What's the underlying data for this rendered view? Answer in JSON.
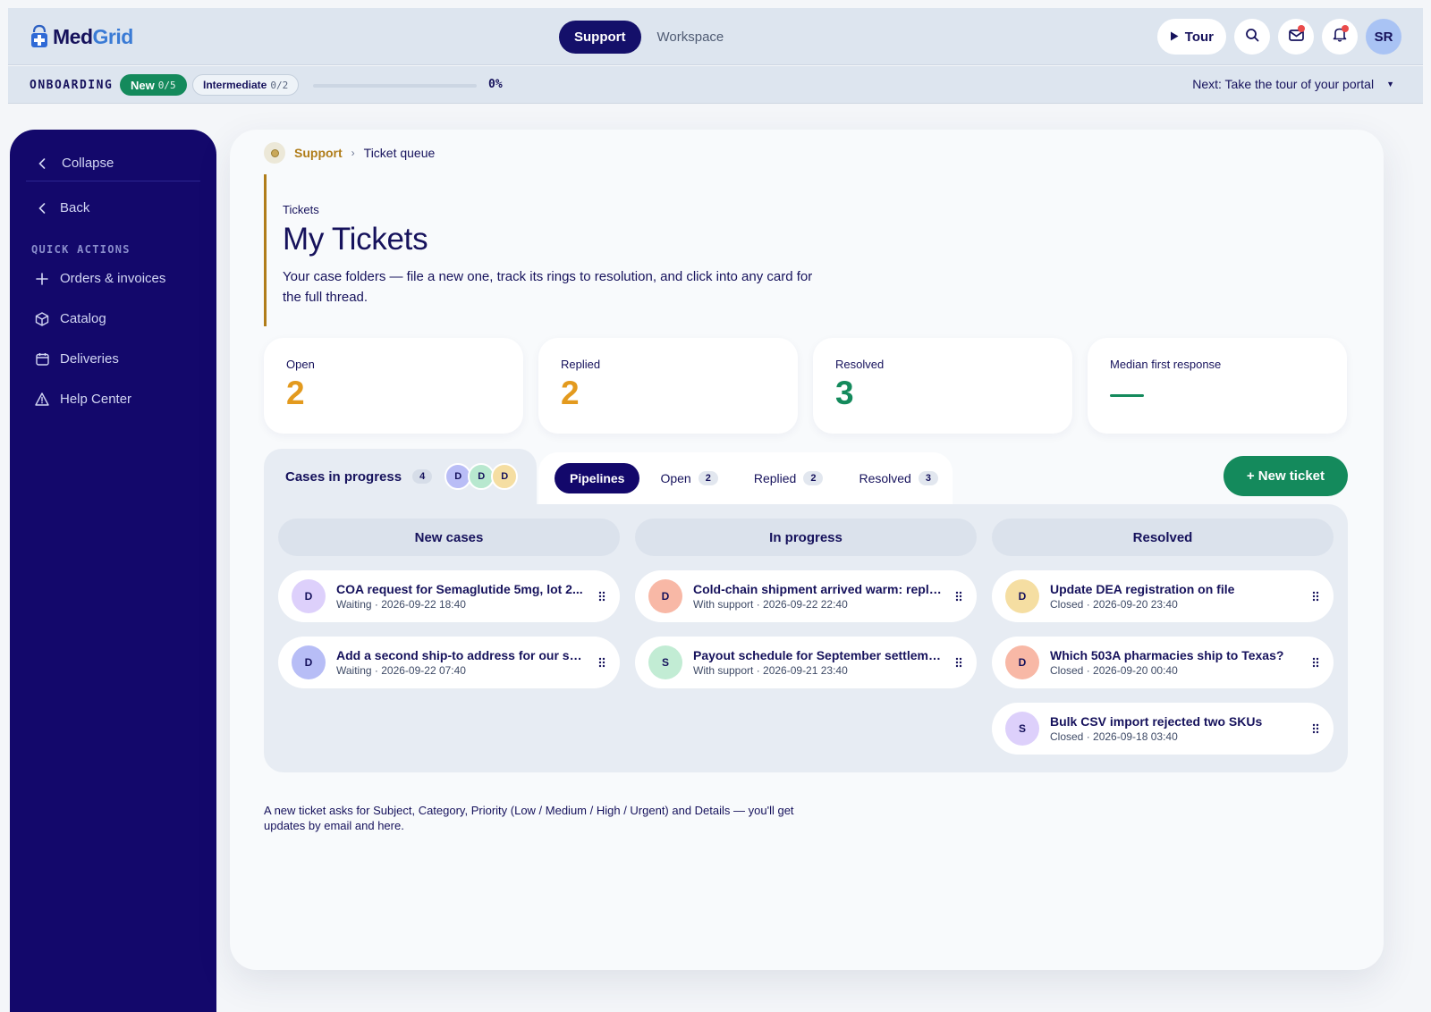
{
  "brand": {
    "name_part1": "Med",
    "name_part2": "Grid"
  },
  "header": {
    "nav": [
      {
        "label": "Support",
        "active": true
      },
      {
        "label": "Workspace",
        "active": false
      }
    ],
    "tour_label": "Tour",
    "user_initials": "SR",
    "icons": [
      "play-icon",
      "search-icon",
      "mail-icon",
      "bell-icon"
    ]
  },
  "onboarding": {
    "label": "ONBOARDING",
    "new_label": "New",
    "new_count": "0/5",
    "intermediate_label": "Intermediate",
    "intermediate_count": "0/2",
    "progress_percent": 0,
    "progress_text": "0%",
    "next_text": "Next: Take the tour of your portal"
  },
  "sidebar": {
    "collapse": "Collapse",
    "back": "Back",
    "section_heading": "QUICK ACTIONS",
    "items": [
      {
        "label": "Orders & invoices",
        "icon": "plus-icon"
      },
      {
        "label": "Catalog",
        "icon": "box-icon"
      },
      {
        "label": "Deliveries",
        "icon": "calendar-icon"
      },
      {
        "label": "Help Center",
        "icon": "warning-icon"
      }
    ]
  },
  "breadcrumb": {
    "root": "Support",
    "current": "Ticket queue"
  },
  "hero": {
    "eyebrow": "Tickets",
    "title": "My Tickets",
    "description": "Your case folders — file a new one, track its rings to resolution, and click into any card for the full thread."
  },
  "stats": [
    {
      "label": "Open",
      "value": "2",
      "color": "#e39a1e"
    },
    {
      "label": "Replied",
      "value": "2",
      "color": "#e39a1e"
    },
    {
      "label": "Resolved",
      "value": "3",
      "color": "#148a5c"
    },
    {
      "label": "Median first response",
      "value": "",
      "color": "#148a5c"
    }
  ],
  "board": {
    "cases_title": "Cases in progress",
    "cases_count": "4",
    "avatars": [
      {
        "initial": "D",
        "color": "#b9bdf6"
      },
      {
        "initial": "D",
        "color": "#b8e8cf"
      },
      {
        "initial": "D",
        "color": "#f5dea2"
      }
    ],
    "tabs": [
      {
        "label": "Pipelines",
        "count": "",
        "active": true
      },
      {
        "label": "Open",
        "count": "2",
        "active": false
      },
      {
        "label": "Replied",
        "count": "2",
        "active": false
      },
      {
        "label": "Resolved",
        "count": "3",
        "active": false
      }
    ],
    "new_ticket_label": "+ New ticket",
    "columns": [
      {
        "title": "New cases",
        "cards": [
          {
            "initial": "D",
            "avatar_color": "#ddd0fb",
            "title": "COA request for Semaglutide 5mg, lot 2...",
            "meta": "Waiting · 2026-09-22 18:40"
          },
          {
            "initial": "D",
            "avatar_color": "#b7bdf6",
            "title": "Add a second ship-to address for our sat...",
            "meta": "Waiting · 2026-09-22 07:40"
          }
        ]
      },
      {
        "title": "In progress",
        "cards": [
          {
            "initial": "D",
            "avatar_color": "#f8b8a6",
            "title": "Cold-chain shipment arrived warm: repla...",
            "meta": "With support · 2026-09-22 22:40"
          },
          {
            "initial": "S",
            "avatar_color": "#c2ecd4",
            "title": "Payout schedule for September settleme...",
            "meta": "With support · 2026-09-21 23:40"
          }
        ]
      },
      {
        "title": "Resolved",
        "cards": [
          {
            "initial": "D",
            "avatar_color": "#f5dea2",
            "title": "Update DEA registration on file",
            "meta": "Closed · 2026-09-20 23:40"
          },
          {
            "initial": "D",
            "avatar_color": "#f8b8a6",
            "title": "Which 503A pharmacies ship to Texas?",
            "meta": "Closed · 2026-09-20 00:40"
          },
          {
            "initial": "S",
            "avatar_color": "#ddd0fb",
            "title": "Bulk CSV import rejected two SKUs",
            "meta": "Closed · 2026-09-18 03:40"
          }
        ]
      }
    ]
  },
  "footnote": "A new ticket asks for Subject, Category, Priority (Low / Medium / High / Urgent) and Details — you'll get updates by email and here."
}
